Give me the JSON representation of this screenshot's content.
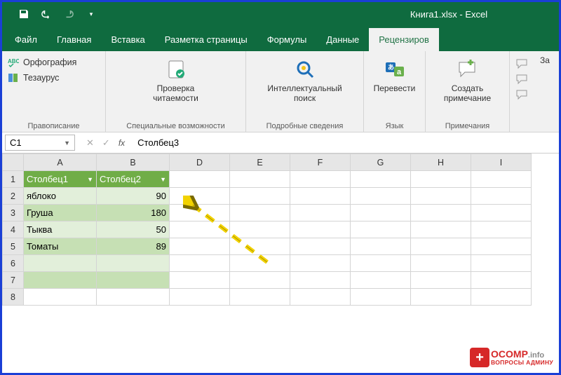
{
  "title": "Книга1.xlsx  -  Excel",
  "tabs": [
    "Файл",
    "Главная",
    "Вставка",
    "Разметка страницы",
    "Формулы",
    "Данные",
    "Рецензиров"
  ],
  "active_tab_index": 6,
  "ribbon": {
    "groups": [
      {
        "label": "Правописание",
        "items": [
          {
            "name": "spelling",
            "label": "Орфография"
          },
          {
            "name": "thesaurus",
            "label": "Тезаурус"
          }
        ]
      },
      {
        "label": "Специальные возможности",
        "items": [
          {
            "name": "accessibility",
            "label": "Проверка\nчитаемости"
          }
        ]
      },
      {
        "label": "Подробные сведения",
        "items": [
          {
            "name": "smart-lookup",
            "label": "Интеллектуальный\nпоиск"
          }
        ]
      },
      {
        "label": "Язык",
        "items": [
          {
            "name": "translate",
            "label": "Перевести"
          }
        ]
      },
      {
        "label": "Примечания",
        "items": [
          {
            "name": "new-comment",
            "label": "Создать\nпримечание"
          }
        ]
      },
      {
        "label": "",
        "items": [
          {
            "name": "more",
            "label": "За"
          }
        ]
      }
    ]
  },
  "namebox": "C1",
  "formula_bar": "Столбец3",
  "sheet": {
    "columns": [
      "A",
      "B",
      "D",
      "E",
      "F",
      "G",
      "H",
      "I"
    ],
    "rows": [
      1,
      2,
      3,
      4,
      5,
      6,
      7,
      8
    ],
    "table": {
      "headers": [
        "Столбец1",
        "Столбец2"
      ],
      "data": [
        {
          "a": "яблоко",
          "b": 90
        },
        {
          "a": "Груша",
          "b": 180
        },
        {
          "a": "Тыква",
          "b": 50
        },
        {
          "a": "Томаты",
          "b": 89
        }
      ]
    }
  },
  "watermark": {
    "main": "OCOMP",
    "suffix": ".info",
    "sub": "ВОПРОСЫ АДМИНУ"
  }
}
